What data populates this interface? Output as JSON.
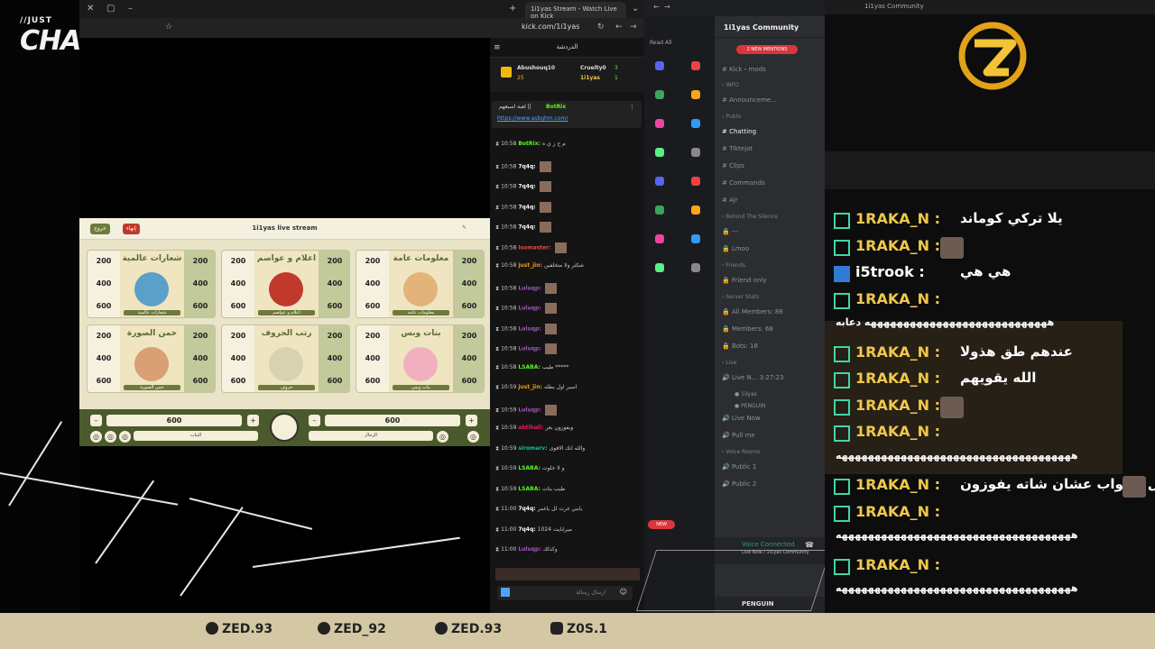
{
  "brand": {
    "top": "//JUST",
    "main": "CHATTING"
  },
  "browser": {
    "tab_title": "1i1yas Stream - Watch Live on Kick",
    "url": "kick.com/1i1yas"
  },
  "game": {
    "header_title": "1i1yas live stream",
    "btn_end": "إنهاء",
    "btn_exit": "خروج",
    "categories": [
      {
        "title": "شعارات عالمية",
        "label": "شعارات عالمية",
        "values": [
          "200",
          "400",
          "600"
        ]
      },
      {
        "title": "اعلام و عواصم",
        "label": "اعلام و عواصم",
        "values": [
          "200",
          "400",
          "600"
        ]
      },
      {
        "title": "معلومات عامة",
        "label": "معلومات عامة",
        "values": [
          "200",
          "400",
          "600"
        ]
      },
      {
        "title": "خمن الصورة",
        "label": "خمن الصورة",
        "values": [
          "200",
          "400",
          "600"
        ]
      },
      {
        "title": "رتب الحروف",
        "label": "حروف",
        "values": [
          "200",
          "400",
          "600"
        ]
      },
      {
        "title": "بنات وبس",
        "label": "بنات وبس",
        "values": [
          "200",
          "400",
          "600"
        ]
      }
    ],
    "team_left": {
      "score": "600",
      "name": "البنات"
    },
    "team_right": {
      "score": "600",
      "name": "الرجال"
    }
  },
  "kick_chat": {
    "header": "الدردشة",
    "top_users": [
      {
        "name": "Abushouq10",
        "count": "25"
      },
      {
        "name": "Cruelty0",
        "count": "3"
      },
      {
        "name": "1i1yas",
        "count": "1"
      }
    ],
    "pinned": {
      "user": "BotRix",
      "text": "لعبة اسبغهم ||",
      "link": "https://www.asbghm.com/"
    },
    "messages": [
      {
        "time": "10:58",
        "user": "BotRix",
        "text": "م ح ز ي ه"
      },
      {
        "time": "10:58",
        "user": "7q4q",
        "text": ""
      },
      {
        "time": "10:58",
        "user": "7q4q",
        "text": ""
      },
      {
        "time": "10:58",
        "user": "7q4q",
        "text": ""
      },
      {
        "time": "10:58",
        "user": "7q4q",
        "text": ""
      },
      {
        "time": "10:58",
        "user": "Isomaster",
        "text": ""
      },
      {
        "time": "10:58",
        "user": "just_jin",
        "text": "شكثر ولا متخلفين"
      },
      {
        "time": "10:58",
        "user": "Luluqp",
        "text": ""
      },
      {
        "time": "10:58",
        "user": "Luluqp",
        "text": ""
      },
      {
        "time": "10:58",
        "user": "Luluqp",
        "text": ""
      },
      {
        "time": "10:58",
        "user": "Luluqp",
        "text": ""
      },
      {
        "time": "10:58",
        "user": "LSABA",
        "text": "طيب *****"
      },
      {
        "time": "10:59",
        "user": "just_jin",
        "text": "اسير اول بطله"
      },
      {
        "time": "10:59",
        "user": "Luluqp",
        "text": ""
      },
      {
        "time": "10:59",
        "user": "abtihali",
        "text": "ويفوزون بعر"
      },
      {
        "time": "10:59",
        "user": "siromarv",
        "text": "والله انك الاقوى"
      },
      {
        "time": "10:59",
        "user": "LSABA",
        "text": "و لا خلوت"
      },
      {
        "time": "10:59",
        "user": "LSABA",
        "text": "طيب بنات"
      },
      {
        "time": "11:00",
        "user": "7q4q",
        "text": "يابني غرت لل ياغمر"
      },
      {
        "time": "11:00",
        "user": "7q4q",
        "text": "1024 ميرابايت"
      },
      {
        "time": "11:00",
        "user": "Luluqp",
        "text": "وكذلك"
      }
    ],
    "input_placeholder": "ارسال رسالة"
  },
  "discord": {
    "server_name": "1i1yas Community",
    "mentions": "2 NEW MENTIONS",
    "read_all": "Read All",
    "channels": [
      {
        "name": "Kick・mods",
        "type": "text"
      },
      {
        "name": "INFO",
        "type": "section"
      },
      {
        "name": "Announceme...",
        "type": "text"
      },
      {
        "name": "Public",
        "type": "section"
      },
      {
        "name": "Chatting",
        "type": "text",
        "active": true
      },
      {
        "name": "Tiktejat",
        "type": "text"
      },
      {
        "name": "Clips",
        "type": "text"
      },
      {
        "name": "Commands",
        "type": "text"
      },
      {
        "name": "Ajr",
        "type": "text"
      },
      {
        "name": "Behind The Silence",
        "type": "section"
      },
      {
        "name": "---",
        "type": "locked"
      },
      {
        "name": "Lmoo",
        "type": "locked"
      },
      {
        "name": "Friends",
        "type": "section"
      },
      {
        "name": "Friend only",
        "type": "locked"
      },
      {
        "name": "Server Stats",
        "type": "section"
      },
      {
        "name": "All Members: 86",
        "type": "locked"
      },
      {
        "name": "Members: 68",
        "type": "locked"
      },
      {
        "name": "Bots: 18",
        "type": "locked"
      },
      {
        "name": "Live",
        "type": "section"
      },
      {
        "name": "Live N...",
        "type": "voice",
        "time": "3:27:23"
      },
      {
        "name": "Live Now",
        "type": "voice"
      },
      {
        "name": "Pull me",
        "type": "voice"
      },
      {
        "name": "Voice Rooms",
        "type": "section"
      },
      {
        "name": "Public 1",
        "type": "voice"
      },
      {
        "name": "Public 2",
        "type": "voice"
      }
    ],
    "voice_users": [
      "1ilyas",
      "PENGUIN"
    ],
    "voice_status": "Voice Connected",
    "voice_channel": "Live Now / 1i1yas Community",
    "new_badge": "NEW",
    "footer_user": "PENGUIN"
  },
  "window": {
    "title": "1i1yas Community"
  },
  "overlay_chat": [
    {
      "user": "1RAKA_N",
      "text": "يلا تركي كوماند",
      "pic": false
    },
    {
      "user": "1RAKA_N",
      "text": "",
      "pic": true
    },
    {
      "user": "i5trook",
      "text": "هي هي",
      "pic": false
    },
    {
      "user": "1RAKA_N",
      "text": "",
      "pic": false
    },
    {
      "user": "",
      "text": "ههههههههههههههههههههههههههههه دعابه",
      "pic": false
    },
    {
      "user": "1RAKA_N",
      "text": "عندهم طق هذولا",
      "pic": false
    },
    {
      "user": "1RAKA_N",
      "text": "الله يقويهم",
      "pic": false
    },
    {
      "user": "1RAKA_N",
      "text": "",
      "pic": true
    },
    {
      "user": "1RAKA_N",
      "text": "",
      "pic": false
    },
    {
      "user": "",
      "text": "ههههههههههههههههههههههههههههههههههههه",
      "pic": false
    },
    {
      "user": "1RAKA_N",
      "text": "يعدل الجواب عشان شاته يفوزون",
      "pic": true
    },
    {
      "user": "1RAKA_N",
      "text": "",
      "pic": false
    },
    {
      "user": "",
      "text": "ههههههههههههههههههههههههههههههههههههه",
      "pic": false
    },
    {
      "user": "1RAKA_N",
      "text": "",
      "pic": false
    },
    {
      "user": "",
      "text": "ههههههههههههههههههههههههههههههههههههه",
      "pic": false
    }
  ],
  "social": [
    {
      "icon": "snapchat-icon",
      "handle": "ZED.93"
    },
    {
      "icon": "x-icon",
      "handle": "ZED_92"
    },
    {
      "icon": "tiktok-icon",
      "handle": "ZED.93"
    },
    {
      "icon": "instagram-icon",
      "handle": "Z0S.1"
    }
  ],
  "colors": {
    "accent_gold": "#f0c84a",
    "kick_green": "#53fc18",
    "game_green": "#6e7a3d",
    "discord_bg": "#2b2d31"
  }
}
